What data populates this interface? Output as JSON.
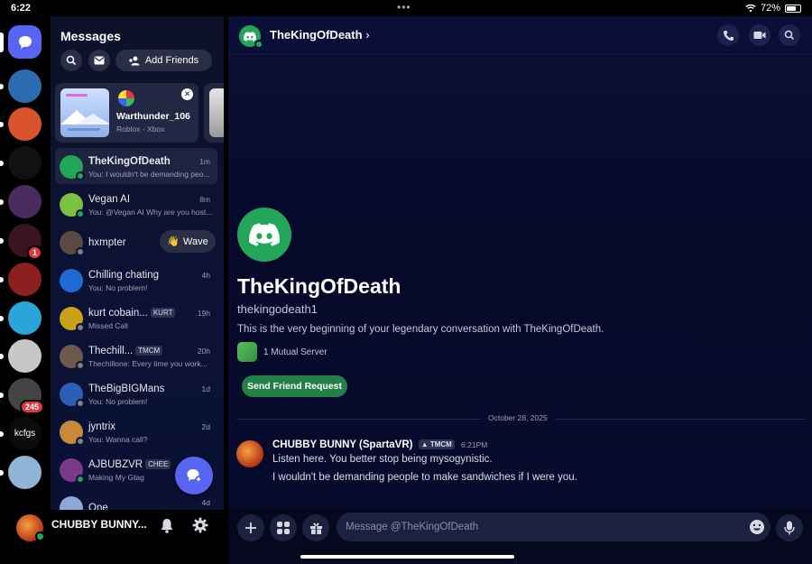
{
  "status_bar": {
    "time": "6:22",
    "battery": "72%",
    "battery_level": 0.72
  },
  "rail": {
    "home_icon": "discord-chat-icon",
    "servers": [
      {
        "name": "server-1",
        "color": "#2b6cb0"
      },
      {
        "name": "server-2",
        "color": "#d9532c"
      },
      {
        "name": "server-3",
        "color": "#111111",
        "letter": ""
      },
      {
        "name": "server-4",
        "color": "#4a2b5e"
      },
      {
        "name": "server-5",
        "color": "#3a1420",
        "badge": "1"
      },
      {
        "name": "server-6",
        "color": "#8c1f1f"
      },
      {
        "name": "server-7",
        "color": "#2aa5d9"
      },
      {
        "name": "server-8",
        "color": "#c7c7c7"
      },
      {
        "name": "server-9",
        "color": "#444444",
        "badge": "245"
      },
      {
        "name": "server-10",
        "color": "#0b0b0b",
        "letter": "kcfgs"
      },
      {
        "name": "server-11",
        "color": "#8fb4d8"
      }
    ]
  },
  "sidebar": {
    "title": "Messages",
    "add_friends_label": "Add Friends",
    "activity": {
      "username": "Warthunder_106",
      "platform": "Roblox - Xbox"
    },
    "dms": [
      {
        "name": "TheKingOfDeath",
        "preview": "You: I wouldn't be demanding peo...",
        "time": "1m",
        "status": "online",
        "color": "#23a55a",
        "selected": true
      },
      {
        "name": "Vegan AI",
        "preview": "You: @Vegan AI Why are you host...",
        "time": "8m",
        "status": "online",
        "color": "#7cc242"
      },
      {
        "name": "hxmpter",
        "preview": "",
        "time": "",
        "status": "offline",
        "color": "#5a4a3f",
        "wave": "Wave"
      },
      {
        "name": "Chilling chating",
        "preview": "You: No problem!",
        "time": "4h",
        "status": "",
        "color": "#1e6bd6"
      },
      {
        "name": "kurt cobain...",
        "tag": "KURT",
        "preview": "Missed Call",
        "time": "19h",
        "status": "offline",
        "color": "#c9a21a"
      },
      {
        "name": "Thechill...",
        "tag": "TMCM",
        "preview": "Thechillone: Every time you work...",
        "time": "20h",
        "status": "offline",
        "color": "#6b5a4a"
      },
      {
        "name": "TheBigBIGMans",
        "preview": "You: No problem!",
        "time": "1d",
        "status": "offline",
        "color": "#2b5fb5"
      },
      {
        "name": "jyntrix",
        "preview": "You: Wanna call?",
        "time": "2d",
        "status": "offline",
        "color": "#c88a3a"
      },
      {
        "name": "AJBUBZVR",
        "tag": "CHEE",
        "preview": "Making My Gtag",
        "time": "",
        "status": "online",
        "color": "#7a3a8a"
      },
      {
        "name": "One",
        "preview": "",
        "time": "4d",
        "status": "",
        "color": "#8fa6d8"
      }
    ]
  },
  "user_bar": {
    "name": "CHUBBY BUNNY..."
  },
  "chat": {
    "header_title": "TheKingOfDeath",
    "profile_name": "TheKingOfDeath",
    "profile_username": "thekingodeath1",
    "intro": "This is the very beginning of your legendary conversation with TheKingOfDeath.",
    "mutual_servers": "1 Mutual Server",
    "send_friend_request": "Send Friend Request",
    "date_divider": "October 28, 2025",
    "message": {
      "author": "CHUBBY BUNNY (SpartaVR)",
      "tag": "TMCM",
      "time": "6:21PM",
      "lines": [
        "Listen here. You better stop being mysogynistic.",
        "I wouldn't be demanding people to make sandwiches if I were you."
      ]
    },
    "composer_placeholder": "Message @TheKingOfDeath"
  },
  "colors": {
    "accent": "#5865f2",
    "online": "#23a55a",
    "green_button": "#248046",
    "badge_red": "#e1373d"
  }
}
